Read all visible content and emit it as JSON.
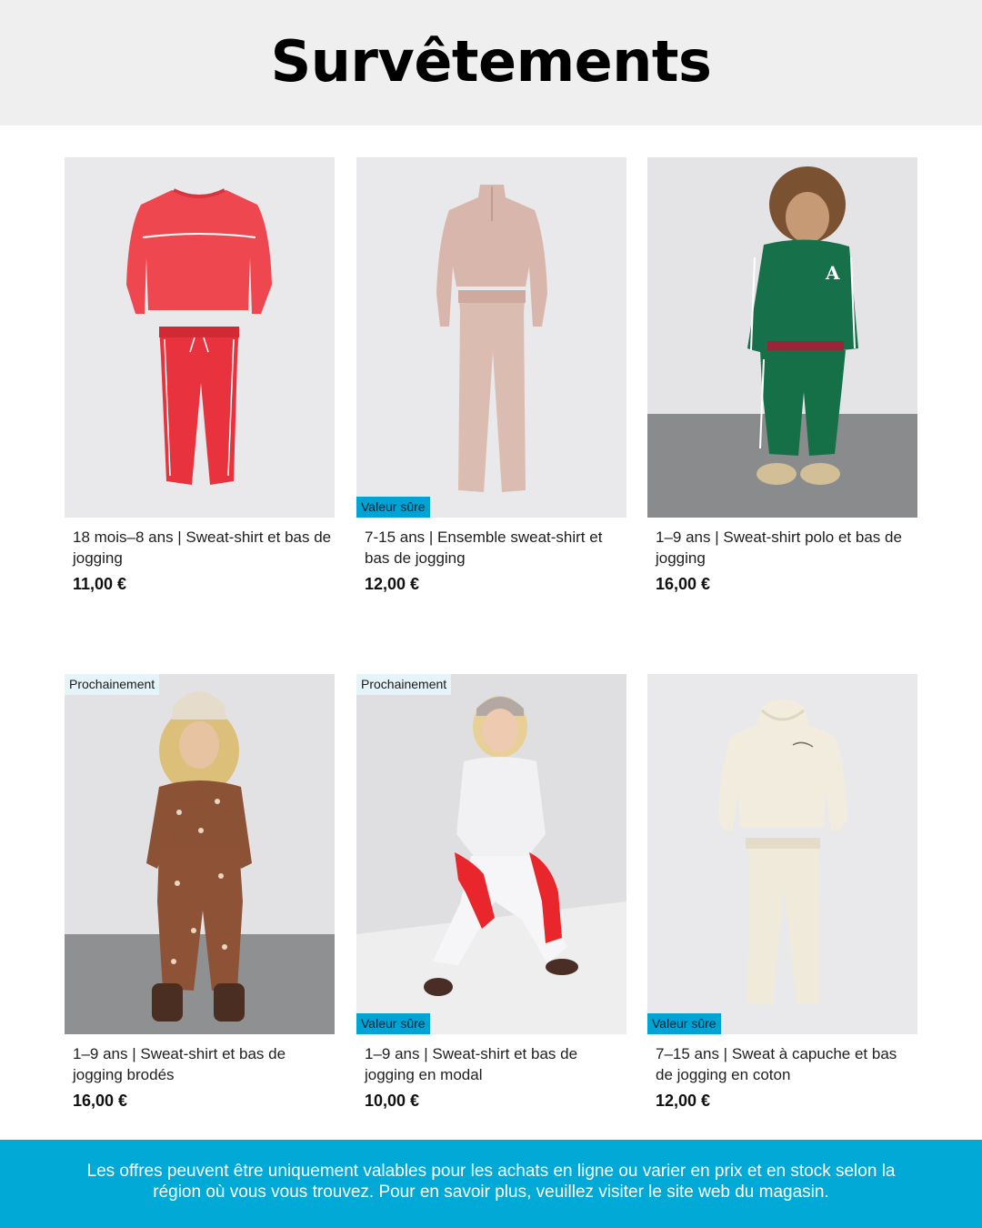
{
  "header": {
    "title": "Survêtements"
  },
  "products": [
    {
      "title": "18 mois–8 ans | Sweat-shirt et bas de jogging",
      "price": "11,00 €",
      "badge_top": "",
      "badge_bottom": ""
    },
    {
      "title": "7-15 ans | Ensemble sweat-shirt et bas de jogging",
      "price": "12,00 €",
      "badge_top": "",
      "badge_bottom": "Valeur sûre"
    },
    {
      "title": "1–9 ans | Sweat-shirt polo et bas de jogging",
      "price": "16,00 €",
      "badge_top": "",
      "badge_bottom": ""
    },
    {
      "title": "1–9 ans | Sweat-shirt et bas de jogging brodés",
      "price": "16,00 €",
      "badge_top": "Prochainement",
      "badge_bottom": ""
    },
    {
      "title": "1–9 ans | Sweat-shirt et bas de jogging en modal",
      "price": "10,00 €",
      "badge_top": "Prochainement",
      "badge_bottom": "Valeur sûre"
    },
    {
      "title": "7–15 ans | Sweat à capuche et bas de jogging en coton",
      "price": "12,00 €",
      "badge_top": "",
      "badge_bottom": "Valeur sûre"
    }
  ],
  "footer": {
    "disclaimer": "Les offres peuvent être uniquement valables pour les achats en ligne ou varier en prix et en stock selon la région où vous vous trouvez. Pour en savoir plus, veuillez visiter le site web du magasin."
  },
  "colors": {
    "header_bg": "#efefef",
    "footer_bg": "#00a9d6",
    "badge_value": "#00a3d3",
    "badge_soon": "#e5f4f8"
  }
}
